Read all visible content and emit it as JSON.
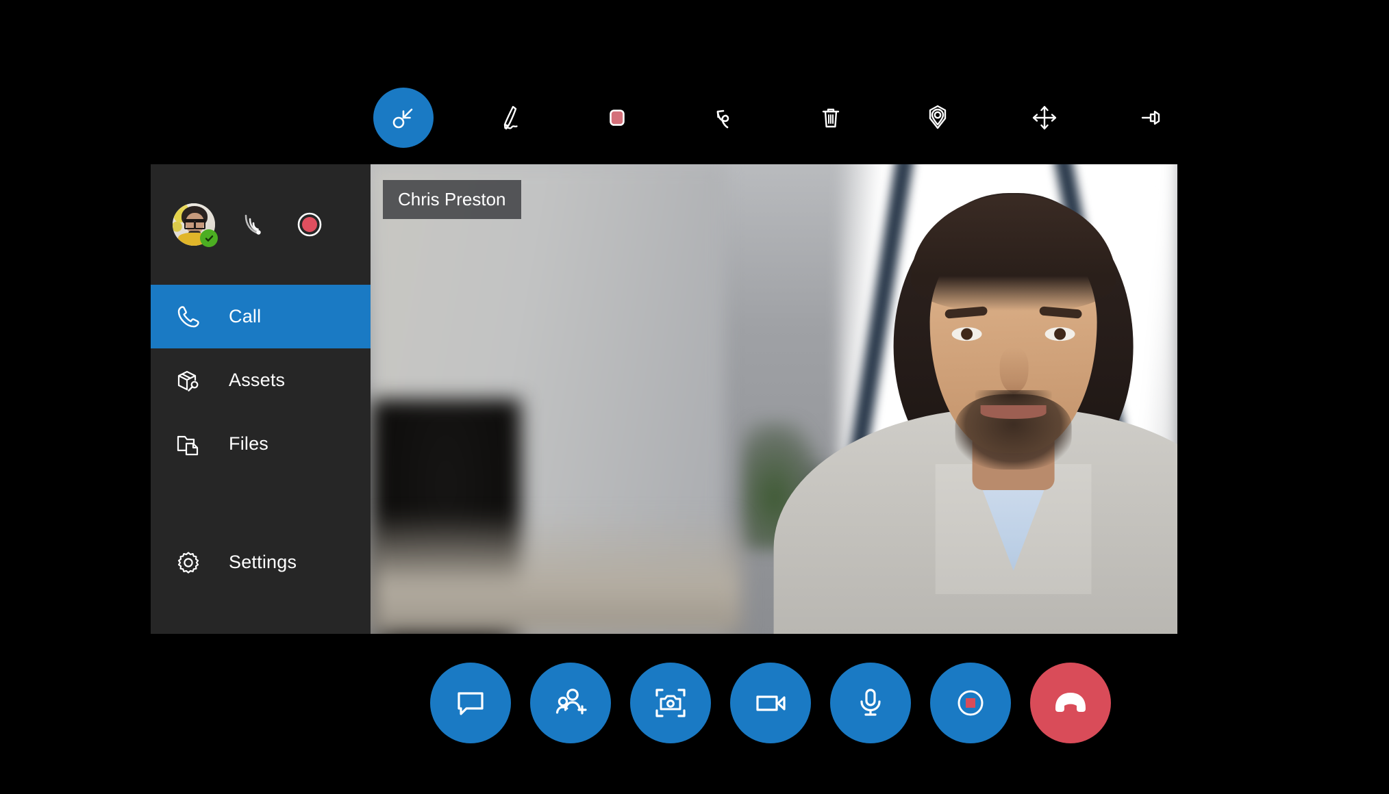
{
  "app": {
    "background_color": "#000000",
    "accent_color": "#1a7ac4",
    "panel_color": "#262626",
    "danger_color": "#d94c59",
    "status_color": "#4cae22",
    "swatch_color": "#d4707a"
  },
  "toolbar": {
    "items": [
      {
        "name": "select-pointer-tool",
        "icon": "pointer-select-icon",
        "label": "Select",
        "active": true
      },
      {
        "name": "pen-tool",
        "icon": "pen-icon",
        "label": "Pen",
        "active": false
      },
      {
        "name": "color-swatch",
        "icon": "color-swatch-icon",
        "label": "Color",
        "active": false,
        "color": "#d4707a"
      },
      {
        "name": "undo-button",
        "icon": "undo-icon",
        "label": "Undo",
        "active": false
      },
      {
        "name": "delete-button",
        "icon": "trash-icon",
        "label": "Delete",
        "active": false
      },
      {
        "name": "place-marker-tool",
        "icon": "location-marker-icon",
        "label": "Place marker",
        "active": false
      },
      {
        "name": "move-tool",
        "icon": "move-arrows-icon",
        "label": "Move",
        "active": false
      },
      {
        "name": "pin-toolbar-button",
        "icon": "pushpin-icon",
        "label": "Pin toolbar",
        "active": false
      }
    ]
  },
  "sidebar": {
    "user": {
      "avatar_alt": "User avatar",
      "status": "available",
      "status_icon": "check-badge-icon"
    },
    "header_icons": [
      {
        "name": "connection-strength-icon",
        "icon": "wifi-signal-icon",
        "label": "Connection strength"
      },
      {
        "name": "recording-indicator",
        "icon": "record-dot-icon",
        "label": "Recording"
      }
    ],
    "items": [
      {
        "label": "Call",
        "icon": "phone-icon",
        "active": true
      },
      {
        "label": "Assets",
        "icon": "box-wrench-icon",
        "active": false
      },
      {
        "label": "Files",
        "icon": "folder-document-icon",
        "active": false
      },
      {
        "label": "Settings",
        "icon": "gear-icon",
        "active": false
      }
    ]
  },
  "video": {
    "participant_name": "Chris Preston"
  },
  "controls": {
    "buttons": [
      {
        "name": "chat-button",
        "icon": "chat-bubble-icon",
        "label": "Chat",
        "style": "primary"
      },
      {
        "name": "add-participant-button",
        "icon": "add-person-icon",
        "label": "Add participant",
        "style": "primary"
      },
      {
        "name": "capture-photo-button",
        "icon": "camera-capture-icon",
        "label": "Capture photo",
        "style": "primary"
      },
      {
        "name": "toggle-video-button",
        "icon": "video-camera-icon",
        "label": "Video",
        "style": "primary"
      },
      {
        "name": "toggle-mic-button",
        "icon": "microphone-icon",
        "label": "Microphone",
        "style": "primary"
      },
      {
        "name": "stop-recording-button",
        "icon": "stop-record-icon",
        "label": "Stop recording",
        "style": "primary"
      },
      {
        "name": "end-call-button",
        "icon": "hang-up-icon",
        "label": "End call",
        "style": "danger"
      }
    ]
  }
}
